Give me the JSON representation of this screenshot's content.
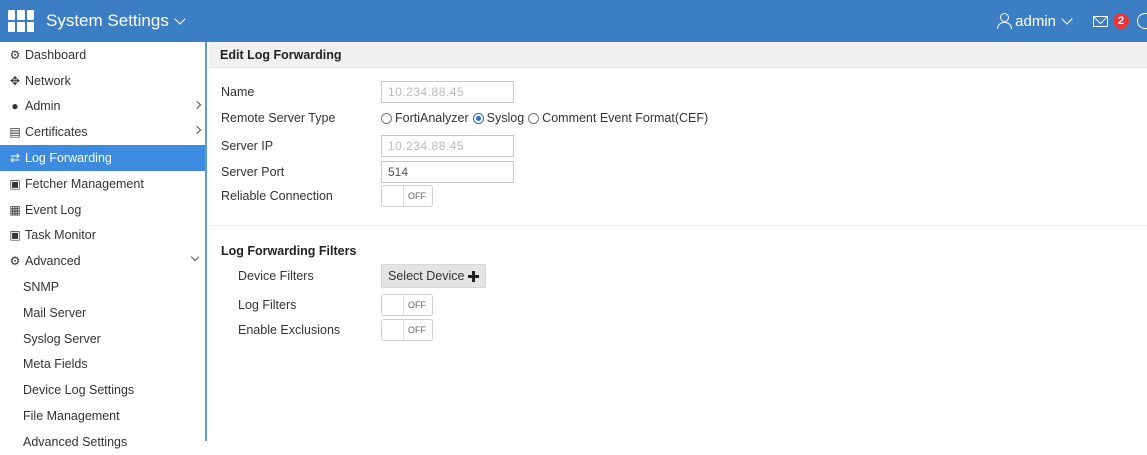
{
  "header": {
    "title": "System Settings",
    "user": "admin",
    "notification_count": "2"
  },
  "sidebar": {
    "items": [
      {
        "label": "Dashboard",
        "icon": "dashboard-icon",
        "glyph": "⚙"
      },
      {
        "label": "Network",
        "icon": "network-icon",
        "glyph": "✥"
      },
      {
        "label": "Admin",
        "icon": "admin-user-icon",
        "glyph": "👤"
      },
      {
        "label": "Certificates",
        "icon": "certificate-icon",
        "glyph": "▤"
      },
      {
        "label": "Log Forwarding",
        "icon": "log-forwarding-icon",
        "glyph": "⇄"
      },
      {
        "label": "Fetcher Management",
        "icon": "fetcher-icon",
        "glyph": "▣"
      },
      {
        "label": "Event Log",
        "icon": "event-log-icon",
        "glyph": "▦"
      },
      {
        "label": "Task Monitor",
        "icon": "task-monitor-icon",
        "glyph": "▣"
      },
      {
        "label": "Advanced",
        "icon": "advanced-icon",
        "glyph": "⚙"
      },
      {
        "label": "SNMP"
      },
      {
        "label": "Mail Server"
      },
      {
        "label": "Syslog Server"
      },
      {
        "label": "Meta Fields"
      },
      {
        "label": "Device Log Settings"
      },
      {
        "label": "File Management"
      },
      {
        "label": "Advanced Settings"
      }
    ]
  },
  "main": {
    "section_title": "Edit Log Forwarding",
    "name_label": "Name",
    "name_value": "10.234.88.45",
    "remote_server_type_label": "Remote Server Type",
    "server_types": [
      {
        "label": "FortiAnalyzer",
        "selected": false
      },
      {
        "label": "Syslog",
        "selected": true
      },
      {
        "label": "Comment Event Format(CEF)",
        "selected": false
      }
    ],
    "server_ip_label": "Server IP",
    "server_ip_value": "10.234.88.45",
    "server_port_label": "Server Port",
    "server_port_value": "514",
    "reliable_label": "Reliable Connection",
    "reliable_state": "OFF",
    "filters_title": "Log Forwarding Filters",
    "device_filters_label": "Device Filters",
    "select_device_label": "Select Device",
    "log_filters_label": "Log Filters",
    "log_filters_state": "OFF",
    "exclusions_label": "Enable Exclusions",
    "exclusions_state": "OFF"
  },
  "colors": {
    "topbar": "#3c7ec3",
    "active_item": "#3c8be0",
    "badge": "#e23a3a"
  }
}
